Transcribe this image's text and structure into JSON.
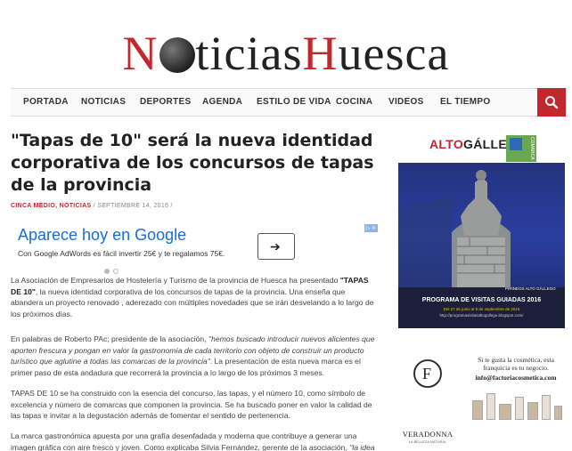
{
  "site": {
    "logo_part1": "N",
    "logo_part2": "ticias",
    "logo_part3": "H",
    "logo_part4": "uesca"
  },
  "nav": {
    "items": [
      "PORTADA",
      "NOTICIAS",
      "DEPORTES",
      "AGENDA",
      "ESTILO DE VIDA",
      "COCINA",
      "VIDEOS",
      "EL TIEMPO"
    ],
    "search_icon": "search-icon"
  },
  "article": {
    "title": "\"Tapas de 10\" será la nueva identidad corporativa de los concursos de tapas de la provincia",
    "category1": "CINCA MEDIO",
    "category2": "NOTICIAS",
    "date": "SEPTIEMBRE 14, 2016",
    "para1_a": "La Asociación de Empresarios de Hostelería y Turismo de la provincia de Huesca ha presentado ",
    "para1_b": "\"TAPAS DE 10\"",
    "para1_c": ", la nueva identidad corporativa de los concursos de tapas de la provincia. Una enseña que abandera un proyecto renovado , aderezado con múltiples novedades que se irán desvelando a lo largo de los próximos días.",
    "para2_a": "En palabras de Roberto PAc; presidente de la asociación, ",
    "para2_b": "\"hemos buscado introducir nuevos alicientes que aporten frescura y pongan en valor la gastronomía de cada territorio con objeto de construir un producto turístico que aglutine a todas las comarcas de la provincia\"",
    "para2_c": ". La presentación de esta nueva marca es el primer paso de esta andadura que recorrerá la provincia a lo largo de los próximos 3 meses.",
    "para3": "TAPAS DE 10 se ha construido con la esencia del concurso, las tapas, y el número 10, como símbolo de excelencia y número de comarcas que componen la provincia. Se ha buscado poner en valor la calidad de las tapas e invitar a la degustación además de fomentar el sentido de pertenencia.",
    "para4_a": "La marca gastronómica apuesta por una grafía desenfadada y moderna que contribuye a generar una imagen gráfica con aire fresco y joven. Como explicaba Silvia Fernández, gerente de la asociación, ",
    "para4_b": "\"la idea"
  },
  "ad": {
    "title": "Aparece hoy en Google",
    "text": "Con Google AdWords es fácil invertir 25€ y te regalamos 75€.",
    "arrow": "➔",
    "dot_active": "#bbbbbb",
    "dot_inactive": "#dddddd"
  },
  "sidebar": {
    "alto": "ALTO",
    "gallego": "GÁLLEGO",
    "comarca": "COMARCA",
    "pirineos": "PIRINEOS ALTO GÁLLEGO",
    "program_title": "PROGRAMA DE VISITAS GUIADAS 2016",
    "program_dates": "Del 27 de junio al 8 de septiembre de 2016",
    "program_url": "http://programavisitasaltogallego.blogspot.com/",
    "veradonna": "VERADONNA",
    "veradonna_sub": "LA BELLEZA NATURAL",
    "veradonna_letter": "F",
    "factoria_text": "Si te gusta la cosmética, esta franquicia es tu negocio.",
    "factoria_mail": "info@factoriacosmetica.com"
  },
  "colors": {
    "brand_red": "#c4262e",
    "ad_blue": "#1a6dd6"
  }
}
